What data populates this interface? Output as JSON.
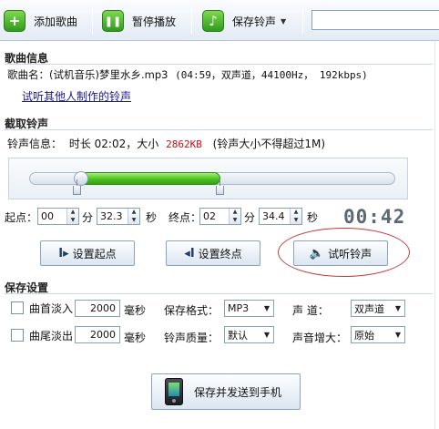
{
  "toolbar": {
    "add_song": "添加歌曲",
    "pause": "暂停播放",
    "save_ringtone": "保存铃声",
    "search_value": ""
  },
  "song_info": {
    "title": "歌曲信息",
    "label": "歌曲名：",
    "value": "(试机音乐)梦里水乡.mp3",
    "details": "(04:59，双声道，44100Hz， 192kbps)",
    "link": "试听其他人制作的铃声"
  },
  "cut": {
    "title": "截取铃声",
    "info_label": "铃声信息：",
    "duration_text": "时长 02:02，大小",
    "size": "2862KB",
    "note": "(铃声大小不得超过1M)",
    "slider": {
      "start_fraction": 0.13,
      "end_fraction": 0.52
    },
    "start_label": "起点：",
    "end_label": "终点：",
    "start_min": "00",
    "start_sec": "32.3",
    "end_min": "02",
    "end_sec": "34.4",
    "min_unit": "分",
    "sec_unit": "秒",
    "lcd_time": "00:42"
  },
  "actions": {
    "set_start": "设置起点",
    "set_end": "设置终点",
    "preview": "试听铃声"
  },
  "save_settings": {
    "title": "保存设置",
    "fade_in_label": "曲首淡入",
    "fade_in_value": "2000",
    "fade_out_label": "曲尾淡出",
    "fade_out_value": "2000",
    "ms_unit": "毫秒",
    "format_label": "保存格式：",
    "format_value": "MP3",
    "quality_label": "铃声质量：",
    "quality_value": "默认",
    "channel_label": "声    道：",
    "channel_value": "双声道",
    "boost_label": "声音增大：",
    "boost_value": "原始",
    "send_button": "保存并发送到手机"
  },
  "colors": {
    "accent_green": "#4cc220",
    "size_red": "#c8101a",
    "highlight_ellipse": "#c23b3b"
  }
}
